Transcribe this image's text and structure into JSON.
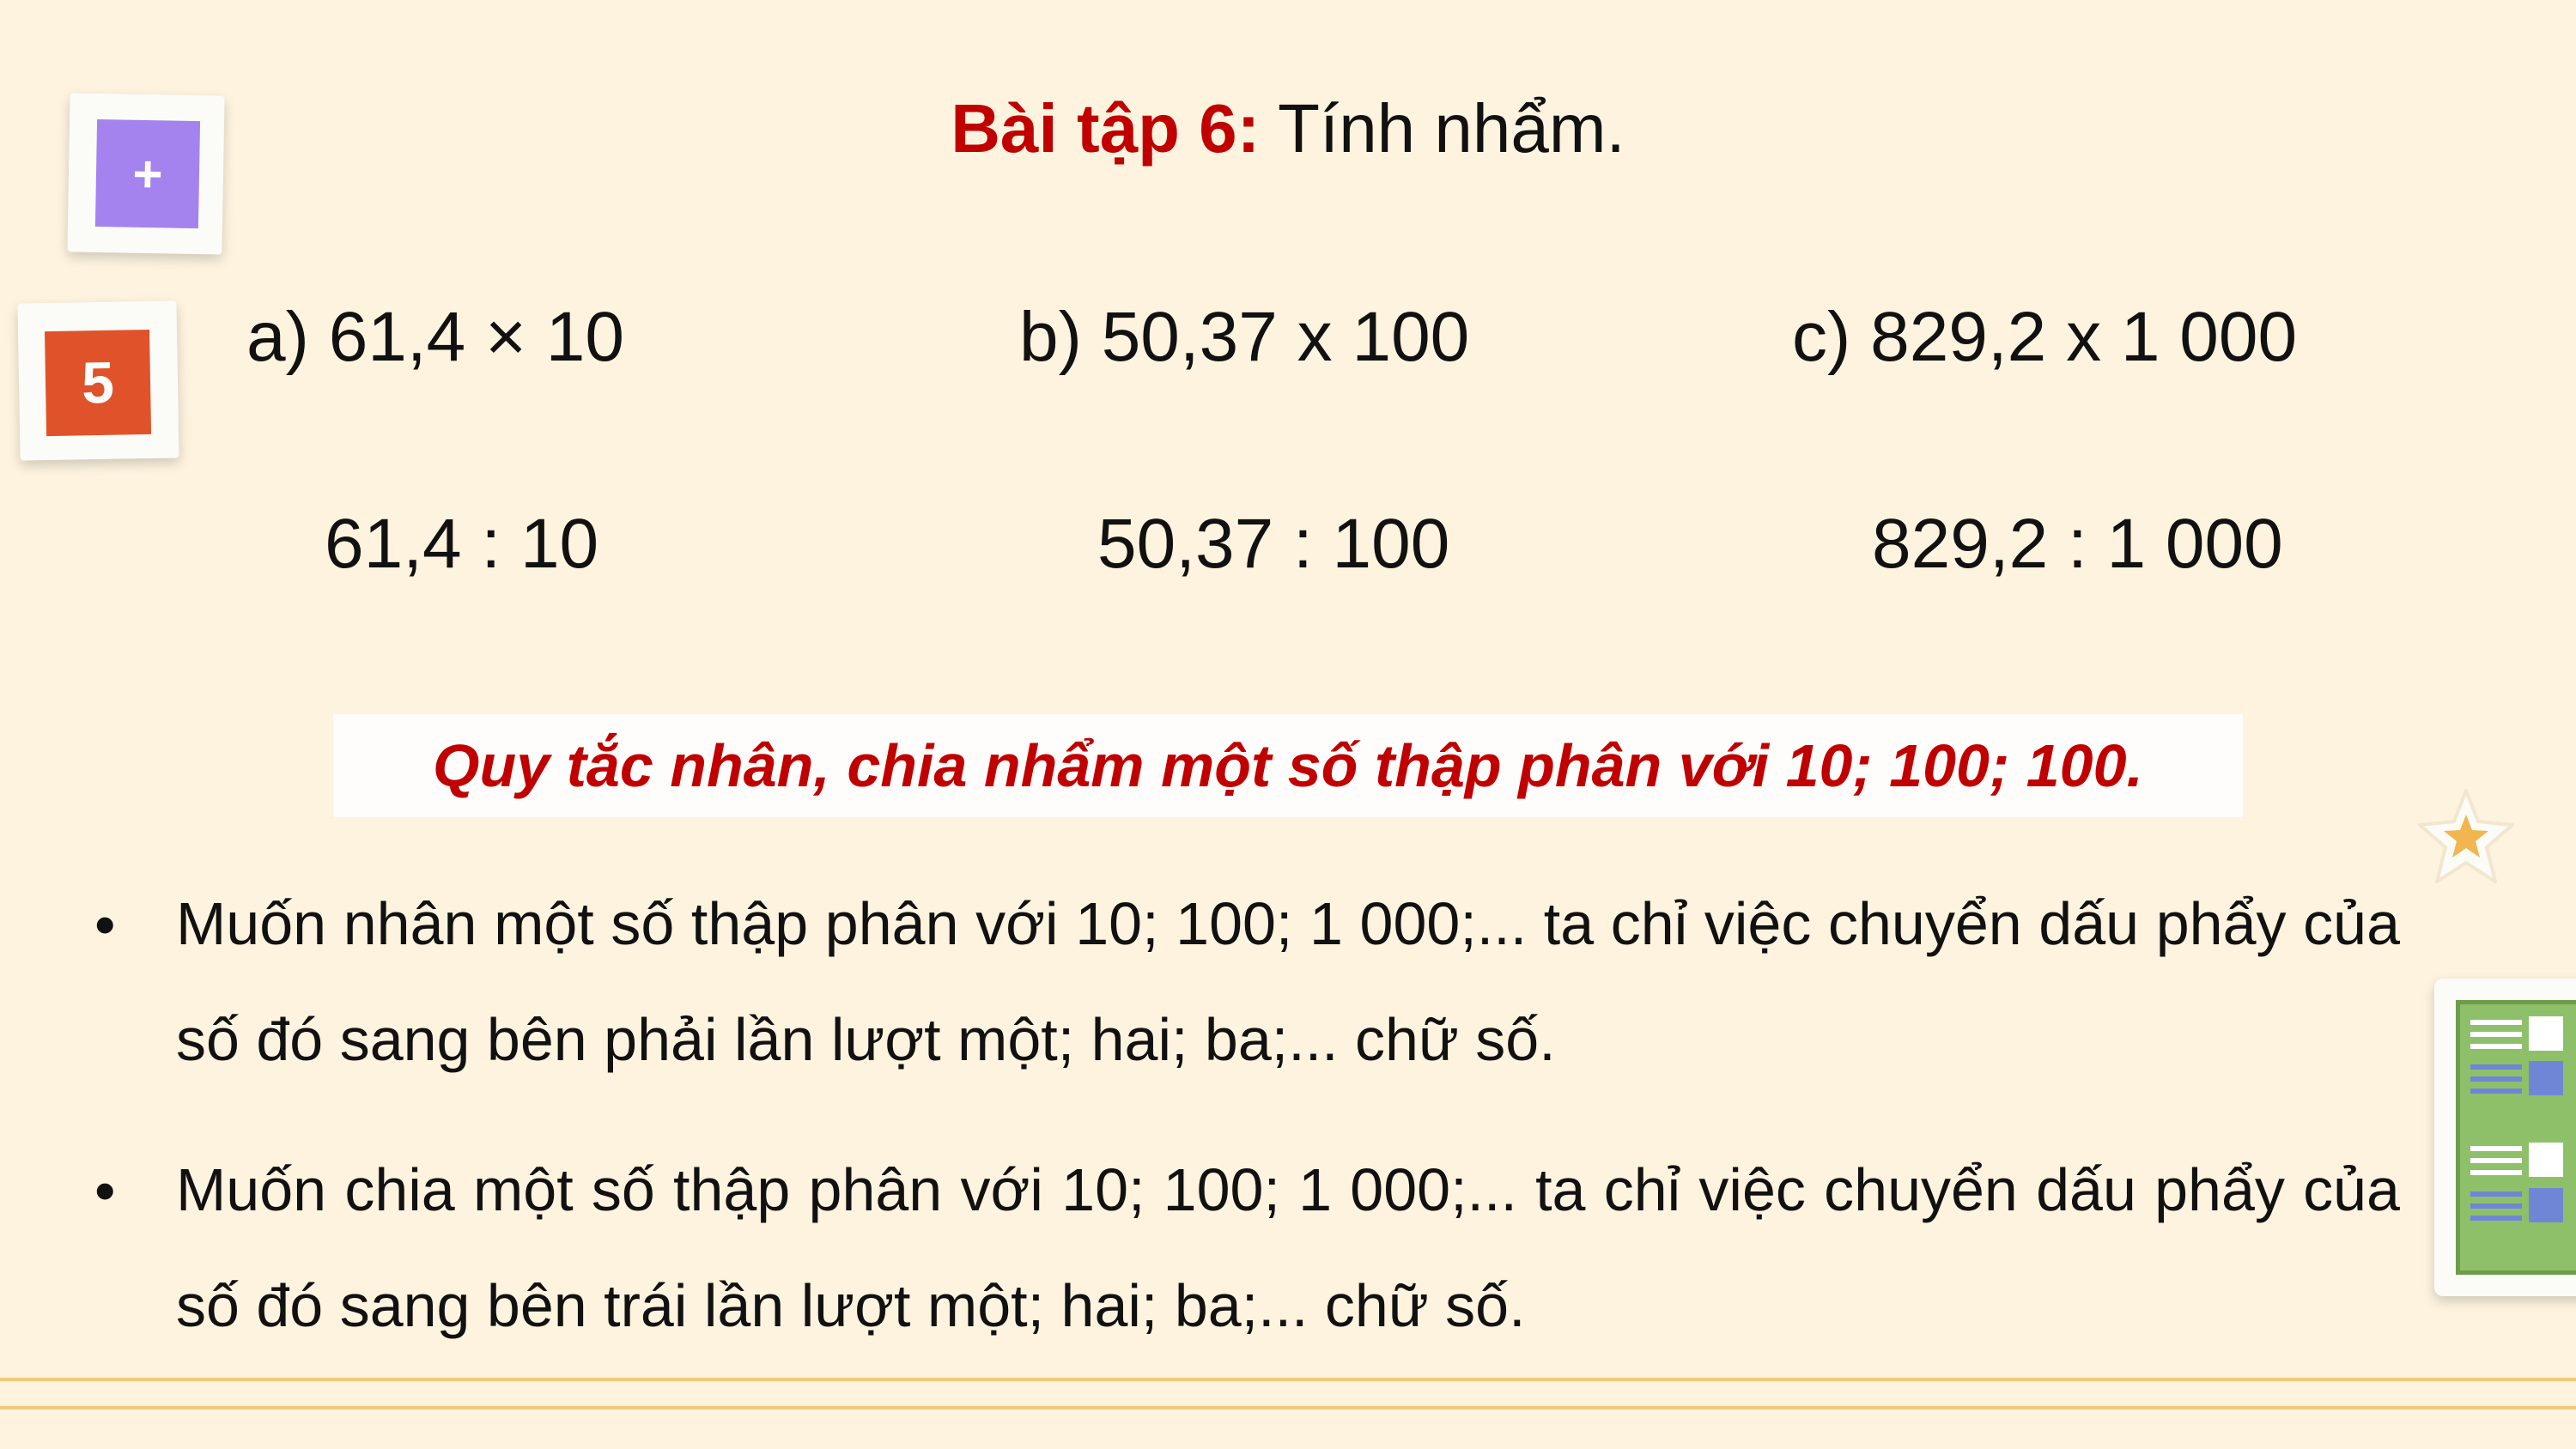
{
  "badges": {
    "plus_symbol": "+",
    "number": "5"
  },
  "title": {
    "label": "Bài tập 6:",
    "text": " Tính nhẩm."
  },
  "exercises": {
    "row1": [
      "a) 61,4 × 10",
      "b) 50,37 x 100",
      "c) 829,2 x 1 000"
    ],
    "row2": [
      "61,4 : 10",
      "50,37 : 100",
      "829,2 : 1 000"
    ]
  },
  "rule": {
    "heading": "Quy tắc nhân, chia nhẩm một số thập phân với 10; 100; 100."
  },
  "bullets": [
    {
      "symbol": "•",
      "text": "Muốn nhân một số thập phân với 10; 100; 1 000;... ta chỉ việc chuyển dấu phẩy của số đó sang bên phải lần lượt một; hai; ba;... chữ số."
    },
    {
      "symbol": "•",
      "text": "Muốn chia một số thập phân với 10; 100; 1 000;... ta chỉ việc chuyển dấu phẩy của số đó sang bên trái lần lượt một; hai; ba;... chữ số."
    }
  ],
  "colors": {
    "background": "#fdf3df",
    "accent_red": "#c00000",
    "badge_purple": "#a483ee",
    "badge_orange": "#e0532a",
    "line_gold": "#f2c977"
  },
  "icons": {
    "plus_badge": "plus-icon",
    "star": "star-icon",
    "notebook": "notebook-icon"
  }
}
